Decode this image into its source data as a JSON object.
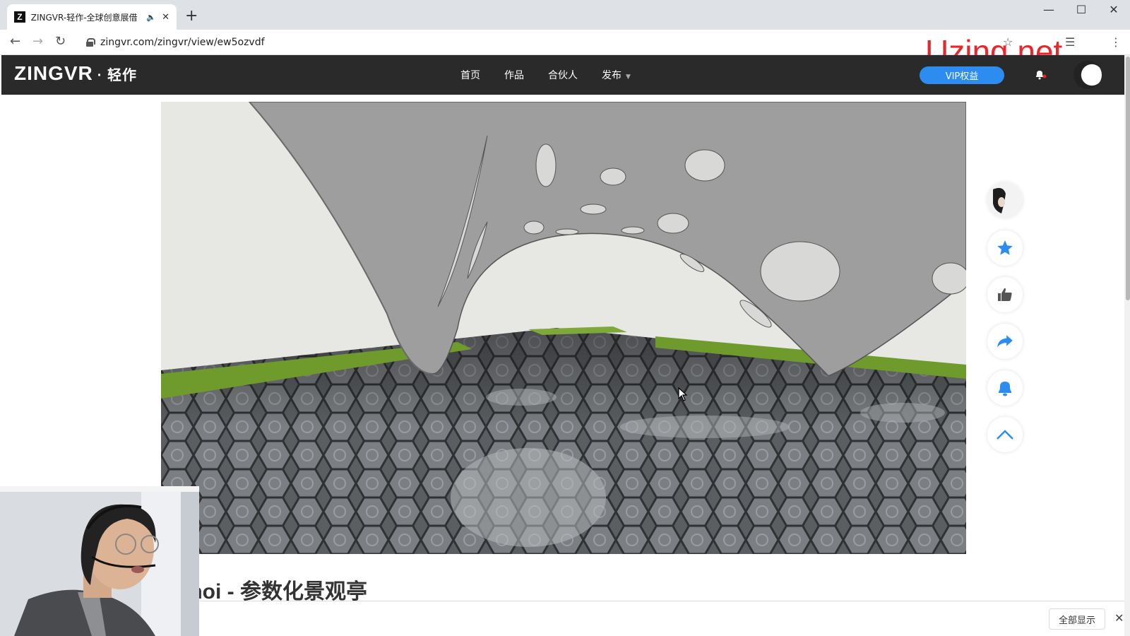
{
  "browser": {
    "tab_title": "ZINGVR-轻作-全球创意展借",
    "favicon_letter": "Z",
    "tab_audio": "🔈",
    "tab_close": "✕",
    "new_tab": "+",
    "url": "zingvr.com/zingvr/view/ew5ozvdf",
    "window_controls": [
      "—",
      "☐",
      "✕"
    ],
    "nav": {
      "back": "←",
      "forward": "→",
      "reload": "↻"
    }
  },
  "watermark": "Uzing.net",
  "site": {
    "logo": "ZINGVR",
    "logo_sub": "· 轻作",
    "nav_items": [
      "首页",
      "作品",
      "合伙人",
      "发布"
    ],
    "vip_label": "VIP权益"
  },
  "work": {
    "title": "onoi - 参数化景观亭"
  },
  "side_actions": [
    "avatar",
    "star-icon",
    "thumbs-up-icon",
    "share-icon",
    "bell-icon",
    "chevron-up-icon"
  ],
  "download_bar": {
    "show_all": "全部显示",
    "close": "✕"
  },
  "colors": {
    "header_bg": "#2a2a2a",
    "vip_blue": "#2d8cf0",
    "action_blue": "#2d8cf0",
    "watermark_red": "#e8262c"
  }
}
